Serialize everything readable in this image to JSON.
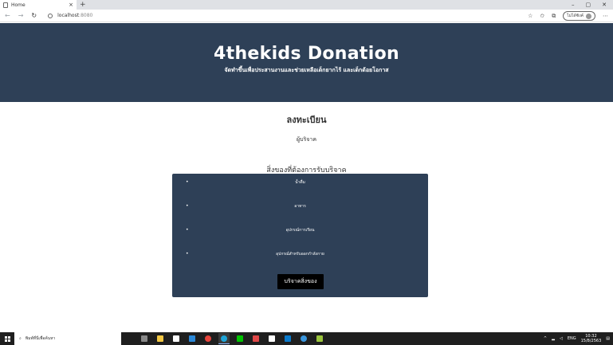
{
  "browser": {
    "tab_title": "Home",
    "tab_close": "×",
    "new_tab": "+",
    "window_controls": [
      "–",
      "▢",
      "✕"
    ],
    "back": "←",
    "forward": "→",
    "reload": "↻",
    "url_host": "localhost",
    "url_port": ":8080",
    "profile_label": "ไม่ได้ซิงค์",
    "more": "⋯"
  },
  "hero": {
    "title": "4thekids Donation",
    "subtitle": "จัดทำขึ้นเพื่อประสานงานและช่วยเหลือเด็กยากไร้ และเด็กด้อยโอกาส"
  },
  "register": {
    "title": "ลงทะเบียน",
    "subtitle": "ผู้บริจาค"
  },
  "needs": {
    "title": "สิ่งของที่ต้องการรับบริจาค",
    "items": [
      "น้ำดื่ม",
      "อาหาร",
      "อุปกรณ์การเรียน",
      "อุปกรณ์สำหรับออกกำลังกาย"
    ],
    "button_label": "บริจาคสิ่งของ"
  },
  "taskbar": {
    "search_placeholder": "พิมพ์ที่นี่เพื่อค้นหา",
    "lang": "ENG",
    "time": "10:32",
    "date": "15/8/2563"
  },
  "colors": {
    "hero_bg": "#2e4057",
    "button_bg": "#000000"
  }
}
